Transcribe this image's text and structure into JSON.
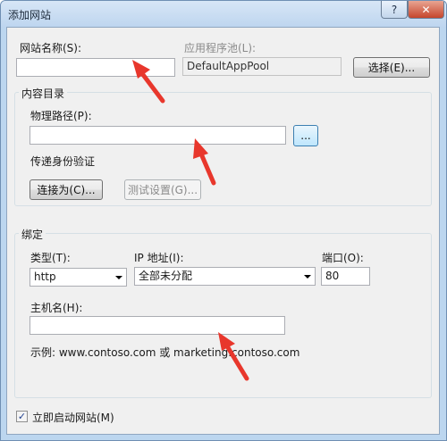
{
  "window": {
    "title": "添加网站",
    "help": "?",
    "close": "✕"
  },
  "site": {
    "name_label": "网站名称(S):",
    "name_value": "",
    "pool_label": "应用程序池(L):",
    "pool_value": "DefaultAppPool",
    "select_button": "选择(E)..."
  },
  "content": {
    "group_title": "内容目录",
    "path_label": "物理路径(P):",
    "path_value": "",
    "browse_button": "...",
    "pass_through_label": "传递身份验证",
    "connect_as_button": "连接为(C)...",
    "test_settings_button": "测试设置(G)..."
  },
  "binding": {
    "group_title": "绑定",
    "type_label": "类型(T):",
    "type_value": "http",
    "ip_label": "IP 地址(I):",
    "ip_value": "全部未分配",
    "port_label": "端口(O):",
    "port_value": "80",
    "host_label": "主机名(H):",
    "host_value": "",
    "example": "示例: www.contoso.com 或 marketing.contoso.com"
  },
  "start": {
    "checked": true,
    "check_mark": "✓",
    "label": "立即启动网站(M)"
  },
  "colors": {
    "arrow": "#e8372c",
    "titlebar": "#bdd5ef",
    "dialog": "#f0f0f0"
  },
  "icons": [
    "help-icon",
    "close-icon",
    "dropdown-arrow-icon",
    "checkmark-icon",
    "red-arrow-annotation"
  ]
}
